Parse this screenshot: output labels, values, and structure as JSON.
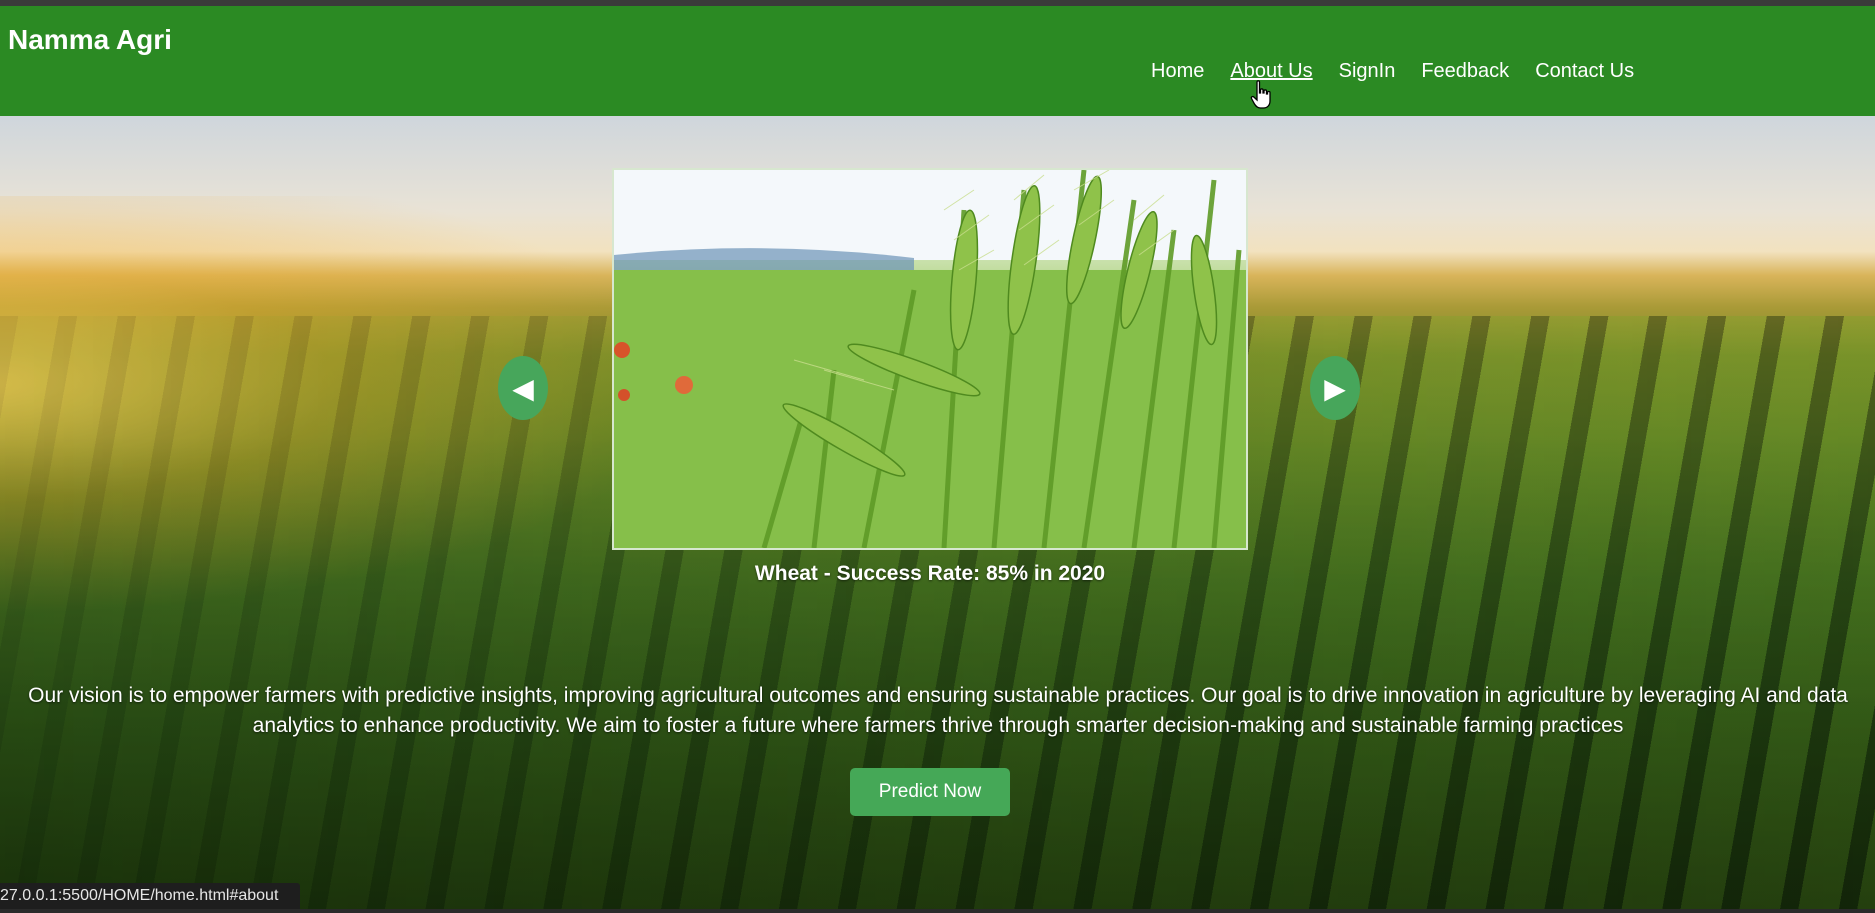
{
  "brand": "Namma Agri",
  "nav": {
    "items": [
      "Home",
      "About Us",
      "SignIn",
      "Feedback",
      "Contact Us"
    ]
  },
  "carousel": {
    "caption": "Wheat - Success Rate: 85% in 2020",
    "prev_icon": "play-left-icon",
    "next_icon": "play-right-icon"
  },
  "vision_text": "Our vision is to empower farmers with predictive insights, improving agricultural outcomes and ensuring sustainable practices. Our goal is to drive innovation in agriculture by leveraging AI and data analytics to enhance productivity. We aim to foster a future where farmers thrive through smarter decision-making and sustainable farming practices",
  "cta_label": "Predict Now",
  "status_url": "27.0.0.1:5500/HOME/home.html#about",
  "colors": {
    "navbar": "#2b8a23",
    "accent": "#45a857"
  }
}
